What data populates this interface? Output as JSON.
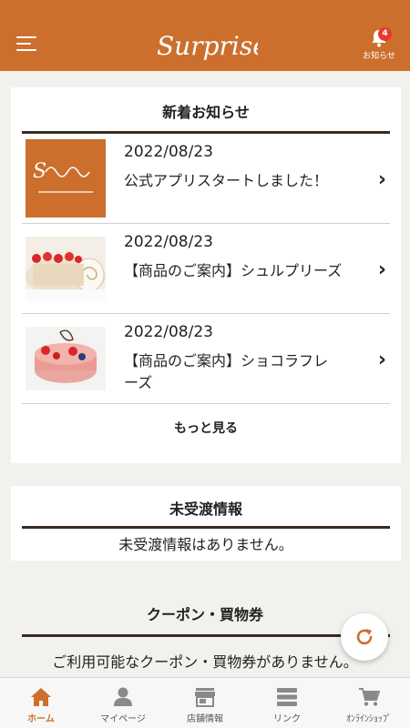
{
  "header": {
    "logo_text": "Surprise",
    "notification_count": "4",
    "notification_label": "お知らせ"
  },
  "news": {
    "title": "新着お知らせ",
    "items": [
      {
        "date": "2022/08/23",
        "text": "公式アプリスタートしました！",
        "thumb": "surprise-logo"
      },
      {
        "date": "2022/08/23",
        "text": "【商品のご案内】シュルプリーズ",
        "thumb": "roll-cake"
      },
      {
        "date": "2022/08/23",
        "text": "【商品のご案内】ショコラフレーズ",
        "thumb": "strawberry-cake"
      }
    ],
    "more_label": "もっと見る"
  },
  "pending": {
    "title": "未受渡情報",
    "message": "未受渡情報はありません。"
  },
  "coupon": {
    "title": "クーポン・買物券",
    "message": "ご利用可能なクーポン・買物券がありません。"
  },
  "tabs": [
    {
      "label": "ホーム",
      "icon": "home-icon",
      "active": true
    },
    {
      "label": "マイページ",
      "icon": "person-icon",
      "active": false
    },
    {
      "label": "店舗情報",
      "icon": "store-icon",
      "active": false
    },
    {
      "label": "リンク",
      "icon": "list-icon",
      "active": false
    },
    {
      "label": "ｵﾝﾗｲﾝｼｮｯﾌﾟ",
      "icon": "cart-icon",
      "active": false
    }
  ],
  "colors": {
    "brand": "#cc6f2c",
    "badge": "#e33a2c",
    "rule": "#3a2a20"
  }
}
